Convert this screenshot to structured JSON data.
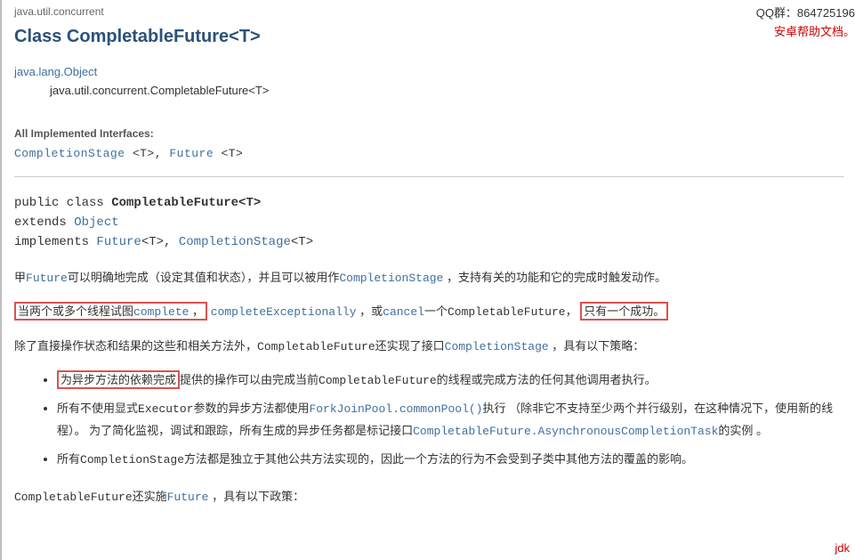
{
  "top_right": {
    "qq": "QQ群：864725196",
    "android": "安卓帮助文档。"
  },
  "pkg": "java.util.concurrent",
  "class_title": "Class CompletableFuture<T>",
  "hierarchy": {
    "root": "java.lang.Object",
    "child": "java.util.concurrent.CompletableFuture<T>"
  },
  "interfaces": {
    "label": "All Implemented Interfaces:",
    "stage": "CompletionStage",
    "stage_gen": " <T>,  ",
    "future": "Future",
    "future_gen": " <T>"
  },
  "sig": {
    "l1a": "public class ",
    "l1b": "CompletableFuture<T>",
    "l2a": "extends ",
    "l2b": "Object",
    "l3a": "implements ",
    "l3b": "Future",
    "l3c": "<T>, ",
    "l3d": "CompletionStage",
    "l3e": "<T>"
  },
  "p1": {
    "a": "甲",
    "future": "Future",
    "b": "可以明确地完成（设定其值和状态），并且可以被用作",
    "stage": "CompletionStage",
    "c": " ，支持有关的功能和它的完成时触发动作。"
  },
  "p2": {
    "box1_a": "当两个或多个线程试图",
    "box1_link": "complete",
    "box1_b": " ，",
    "excp": "completeExceptionally",
    "mid": " ，或",
    "cancel": "cancel",
    "mid2": "一个",
    "cf": "CompletableFuture，",
    "box2": "只有一个成功。"
  },
  "p3": {
    "a": "除了直接操作状态和结果的这些和相关方法外，",
    "cf": "CompletableFuture",
    "b": "还实现了接口",
    "stage": "CompletionStage",
    "c": " ，具有以下策略："
  },
  "li1": {
    "box": "为异步方法的依赖完成",
    "rest": "提供的操作可以由完成当前",
    "cf": "CompletableFuture",
    "rest2": "的线程或完成方法的任何其他调用者执行。"
  },
  "li2": {
    "a": "所有不使用显式",
    "exec": "Executor",
    "b": "参数的异步方法都使用",
    "pool": "ForkJoinPool.commonPool()",
    "c": "执行 （除非它不支持至少两个并行级别，在这种情况下，使用新的线程）。 为了简化监视，调试和跟踪，所有生成的异步任务都是标记接口",
    "task": "CompletableFuture.AsynchronousCompletionTask",
    "d": "的实例 。"
  },
  "li3": {
    "a": "所有",
    "cs": "CompletionStage",
    "b": "方法都是独立于其他公共方法实现的，因此一个方法的行为不会受到子类中其他方法的覆盖的影响。"
  },
  "p4": {
    "cf": "CompletableFuture",
    "a": "还实施",
    "future": "Future",
    "b": " ，具有以下政策："
  },
  "jdk": "jdk"
}
